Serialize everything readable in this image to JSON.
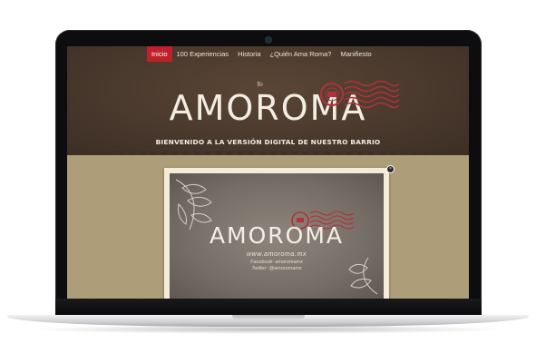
{
  "nav": {
    "items": [
      {
        "label": "Inicio",
        "active": true
      },
      {
        "label": "100 Experiencias",
        "active": false
      },
      {
        "label": "Historia",
        "active": false
      },
      {
        "label": "¿Quién Ama Roma?",
        "active": false
      },
      {
        "label": "Manifiesto",
        "active": false
      }
    ]
  },
  "hero": {
    "pre_title": "Yo",
    "logo": "AMOROMA",
    "tagline": "BIENVENIDO A LA VERSIÓN DIGITAL DE NUESTRO BARRIO"
  },
  "card": {
    "logo": "AMOROMA",
    "url": "www.amoroma.mx",
    "facebook": "Facebook: amoromamx",
    "twitter": "Twitter: @amoromamx"
  },
  "colors": {
    "hero_bg": "#4a392d",
    "accent_red": "#c0202a",
    "lower_bg": "#ad9d79",
    "card_frame": "#f4ecd8"
  },
  "icons": [
    "postmark-stamp-icon",
    "close-icon",
    "leaf-ornament-icon"
  ]
}
